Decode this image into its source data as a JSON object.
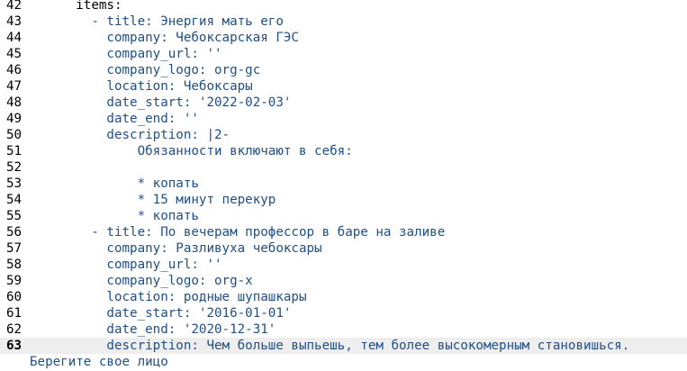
{
  "editor": {
    "lines": [
      {
        "num": "42",
        "text": "      items:",
        "dark": true
      },
      {
        "num": "43",
        "text": "        - title: Энергия мать его"
      },
      {
        "num": "44",
        "text": "          company: Чебоксарская ГЭС"
      },
      {
        "num": "45",
        "text": "          company_url: ''"
      },
      {
        "num": "46",
        "text": "          company_logo: org-gc"
      },
      {
        "num": "47",
        "text": "          location: Чебоксары"
      },
      {
        "num": "48",
        "text": "          date_start: '2022-02-03'"
      },
      {
        "num": "49",
        "text": "          date_end: ''"
      },
      {
        "num": "50",
        "text": "          description: |2-"
      },
      {
        "num": "51",
        "text": "              Обязанности включают в себя:"
      },
      {
        "num": "52",
        "text": ""
      },
      {
        "num": "53",
        "text": "              * копать"
      },
      {
        "num": "54",
        "text": "              * 15 минут перекур"
      },
      {
        "num": "55",
        "text": "              * копать"
      },
      {
        "num": "56",
        "text": "        - title: По вечерам профессор в баре на заливе"
      },
      {
        "num": "57",
        "text": "          company: Разливуха чебоксары"
      },
      {
        "num": "58",
        "text": "          company_url: ''"
      },
      {
        "num": "59",
        "text": "          company_logo: org-x"
      },
      {
        "num": "60",
        "text": "          location: родные шупашкары"
      },
      {
        "num": "61",
        "text": "          date_start: '2016-01-01'"
      },
      {
        "num": "62",
        "text": "          date_end: '2020-12-31'"
      },
      {
        "num": "63",
        "text": "          description: Чем больше выпьешь, тем более высокомерным становишься.",
        "current": true
      },
      {
        "num": "",
        "text": "Берегите свое лицо",
        "wrap": true
      }
    ]
  }
}
